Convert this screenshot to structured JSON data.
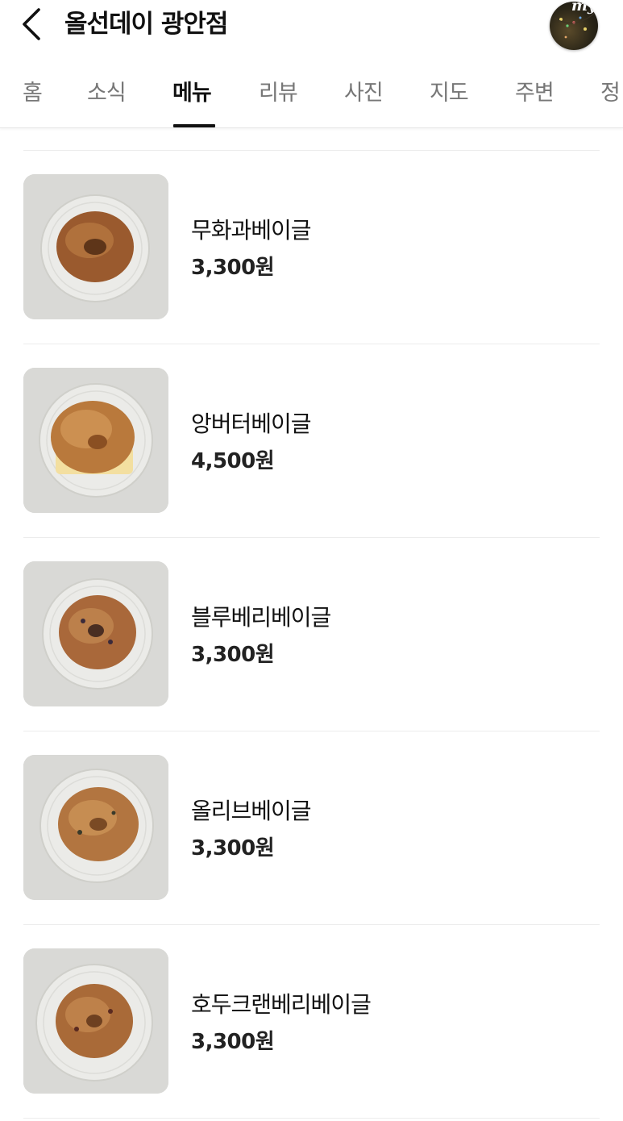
{
  "header": {
    "title": "올선데이 광안점",
    "avatar_badge": "my"
  },
  "tabs": [
    {
      "label": "홈"
    },
    {
      "label": "소식"
    },
    {
      "label": "메뉴"
    },
    {
      "label": "리뷰"
    },
    {
      "label": "사진"
    },
    {
      "label": "지도"
    },
    {
      "label": "주변"
    },
    {
      "label": "정"
    }
  ],
  "active_tab": "메뉴",
  "menu": [
    {
      "name": "무화과베이글",
      "price": "3,300원"
    },
    {
      "name": "앙버터베이글",
      "price": "4,500원"
    },
    {
      "name": "블루베리베이글",
      "price": "3,300원"
    },
    {
      "name": "올리브베이글",
      "price": "3,300원"
    },
    {
      "name": "호두크랜베리베이글",
      "price": "3,300원"
    }
  ]
}
